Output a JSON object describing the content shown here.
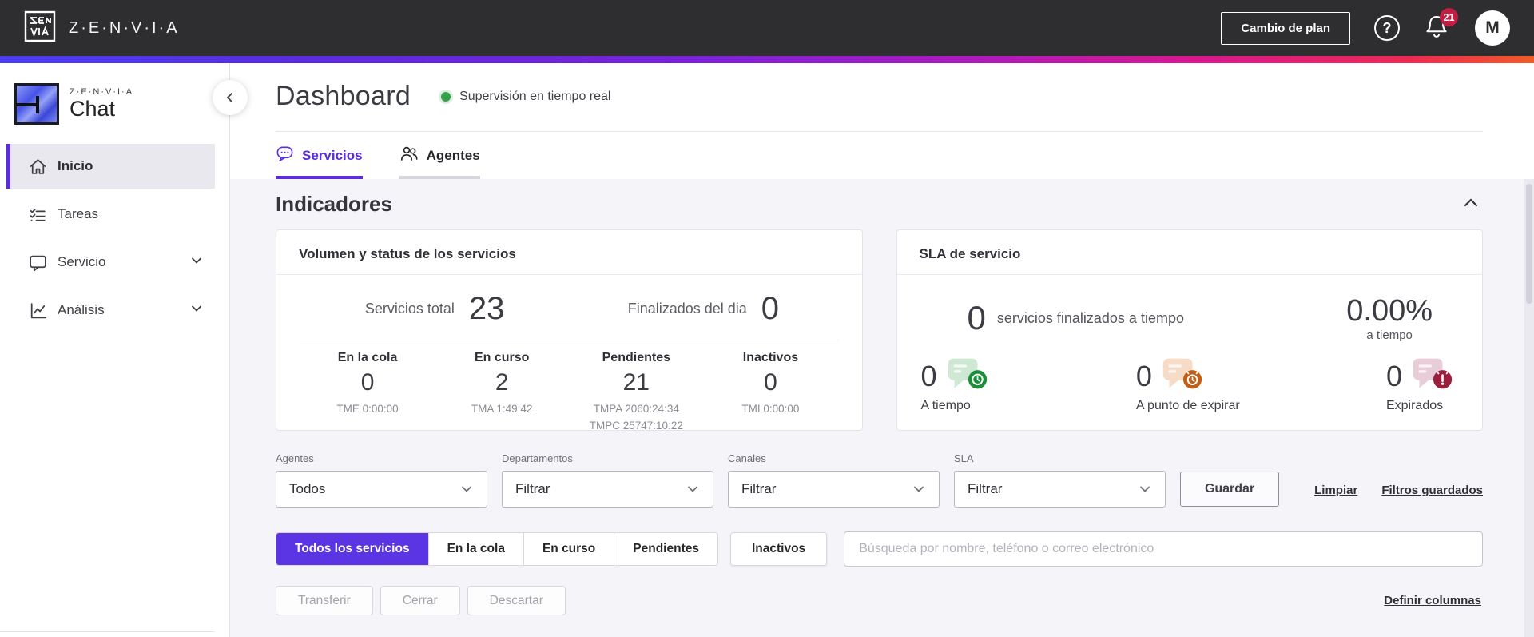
{
  "topbar": {
    "brand": "Z·E·N·V·I·A",
    "change_plan_label": "Cambio de plan",
    "notification_count": "21",
    "avatar_initial": "M"
  },
  "sidebar": {
    "logo_brand": "Z·E·N·V·I·A",
    "logo_product": "Chat",
    "items": [
      {
        "label": "Inicio"
      },
      {
        "label": "Tareas"
      },
      {
        "label": "Servicio"
      },
      {
        "label": "Análisis"
      }
    ]
  },
  "header": {
    "title": "Dashboard",
    "status": "Supervisión en tiempo real"
  },
  "tabs": [
    {
      "label": "Servicios"
    },
    {
      "label": "Agentes"
    }
  ],
  "indicators": {
    "title": "Indicadores",
    "volume_card": {
      "title": "Volumen y status de los servicios",
      "total_label": "Servicios total",
      "total_value": "23",
      "finished_label": "Finalizados del dia",
      "finished_value": "0",
      "stats": [
        {
          "label": "En la cola",
          "value": "0",
          "sub": [
            "TME 0:00:00"
          ]
        },
        {
          "label": "En curso",
          "value": "2",
          "sub": [
            "TMA 1:49:42"
          ]
        },
        {
          "label": "Pendientes",
          "value": "21",
          "sub": [
            "TMPA 2060:24:34",
            "TMPC 25747:10:22"
          ]
        },
        {
          "label": "Inactivos",
          "value": "0",
          "sub": [
            "TMI 0:00:00"
          ]
        }
      ]
    },
    "sla_card": {
      "title": "SLA de servicio",
      "finished_value": "0",
      "finished_label": "servicios finalizados a tiempo",
      "percent_value": "0.00%",
      "percent_label": "a tiempo",
      "stats": [
        {
          "value": "0",
          "label": "A tiempo"
        },
        {
          "value": "0",
          "label": "A punto de expirar"
        },
        {
          "value": "0",
          "label": "Expirados"
        }
      ]
    }
  },
  "filters": {
    "fields": [
      {
        "label": "Agentes",
        "value": "Todos"
      },
      {
        "label": "Departamentos",
        "value": "Filtrar"
      },
      {
        "label": "Canales",
        "value": "Filtrar"
      },
      {
        "label": "SLA",
        "value": "Filtrar"
      }
    ],
    "save_label": "Guardar",
    "clear_label": "Limpiar",
    "saved_filters_label": "Filtros guardados"
  },
  "service_tabs": [
    {
      "label": "Todos los servicios"
    },
    {
      "label": "En la cola"
    },
    {
      "label": "En curso"
    },
    {
      "label": "Pendientes"
    },
    {
      "label": "Inactivos"
    }
  ],
  "search": {
    "placeholder": "Búsqueda por nombre, teléfono o correo electrónico"
  },
  "actions": {
    "transfer_label": "Transferir",
    "close_label": "Cerrar",
    "discard_label": "Descartar",
    "define_columns_label": "Definir columnas"
  },
  "colors": {
    "accent_purple": "#5b2ce0",
    "topbar_dark": "#2e2e31",
    "section_bg": "#f5f4f8",
    "status_green": "#35a04a",
    "badge_red": "#c21d42",
    "sla_on_time_green": "#1d8f3c",
    "sla_expiring_orange": "#c06018",
    "sla_expired_red": "#9b1e3c"
  }
}
